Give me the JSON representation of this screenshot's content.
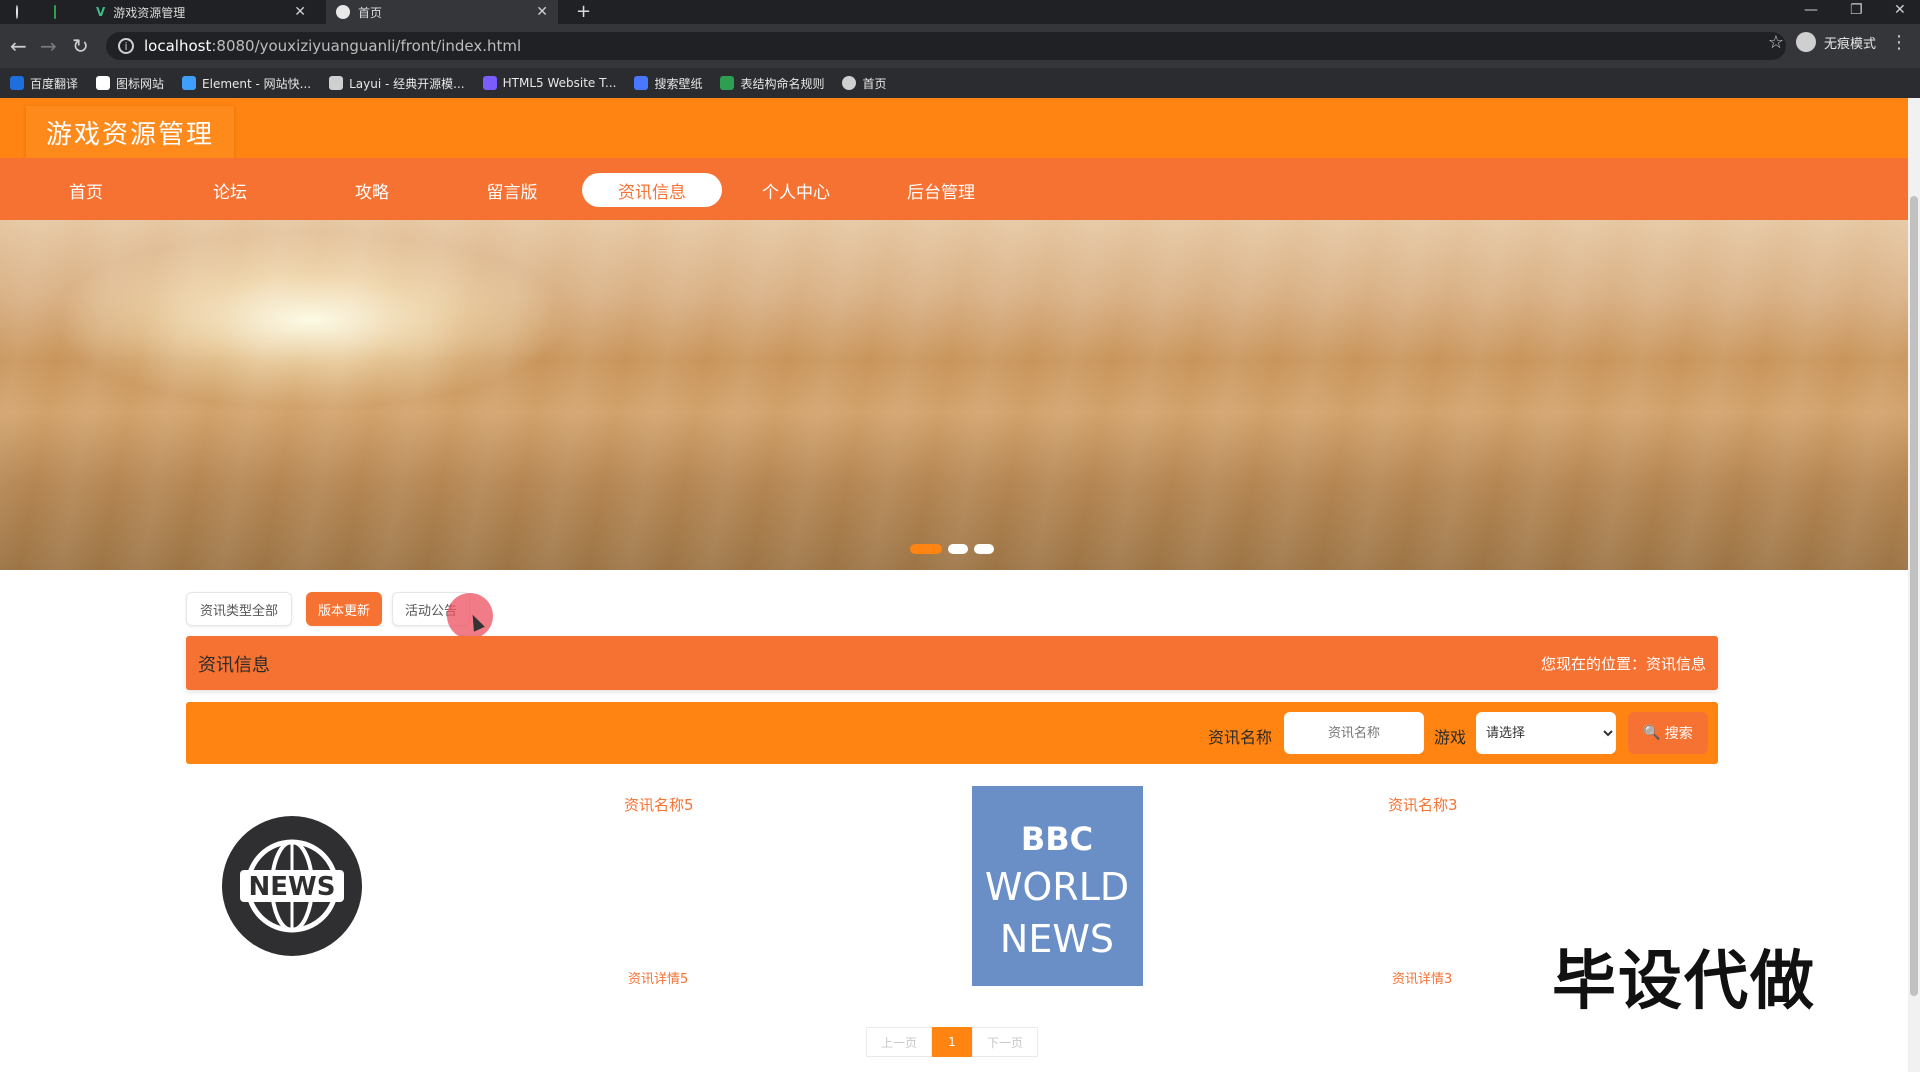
{
  "browser": {
    "tabs": [
      {
        "label": ""
      },
      {
        "label": ""
      },
      {
        "label": "游戏资源管理"
      },
      {
        "label": "首页"
      }
    ],
    "url_host": "localhost",
    "url_path": ":8080/youxiziyuanguanli/front/index.html",
    "profile_label": "无痕模式",
    "bookmarks": [
      {
        "label": "百度翻译",
        "color": "#1e6fdc"
      },
      {
        "label": "图标网站",
        "color": "#ffffff"
      },
      {
        "label": "Element - 网站快...",
        "color": "#409eff"
      },
      {
        "label": "Layui - 经典开源模...",
        "color": "#cfcfcf"
      },
      {
        "label": "HTML5 Website T...",
        "color": "#7b5cff"
      },
      {
        "label": "搜索壁纸",
        "color": "#4a77ff"
      },
      {
        "label": "表结构命名规则",
        "color": "#2e9e50"
      },
      {
        "label": "首页",
        "color": "#cfcfcf"
      }
    ]
  },
  "site": {
    "title": "游戏资源管理",
    "nav": [
      {
        "label": "首页"
      },
      {
        "label": "论坛"
      },
      {
        "label": "攻略"
      },
      {
        "label": "留言版"
      },
      {
        "label": "资讯信息"
      },
      {
        "label": "个人中心"
      },
      {
        "label": "后台管理"
      }
    ]
  },
  "filters": [
    {
      "label": "资讯类型全部"
    },
    {
      "label": "版本更新"
    },
    {
      "label": "活动公告"
    }
  ],
  "section": {
    "title": "资讯信息",
    "breadcrumb": "您现在的位置：资讯信息"
  },
  "search": {
    "name_label": "资讯名称",
    "name_placeholder": "资讯名称",
    "game_label": "游戏",
    "game_selected": "请选择",
    "button_label": "搜索"
  },
  "news": [
    {
      "name": "资讯名称5",
      "detail": "资讯详情5"
    },
    {
      "name": "资讯名称3",
      "detail": "资讯详情3"
    }
  ],
  "news_icon_text": "NEWS",
  "bbc_lines": [
    "BBC",
    "WORLD",
    "NEWS"
  ],
  "pagination": {
    "prev": "上一页",
    "current": "1",
    "next": "下一页"
  },
  "watermark": "毕设代做",
  "colors": {
    "accent": "#ff8411",
    "accent_dark": "#f67233"
  }
}
